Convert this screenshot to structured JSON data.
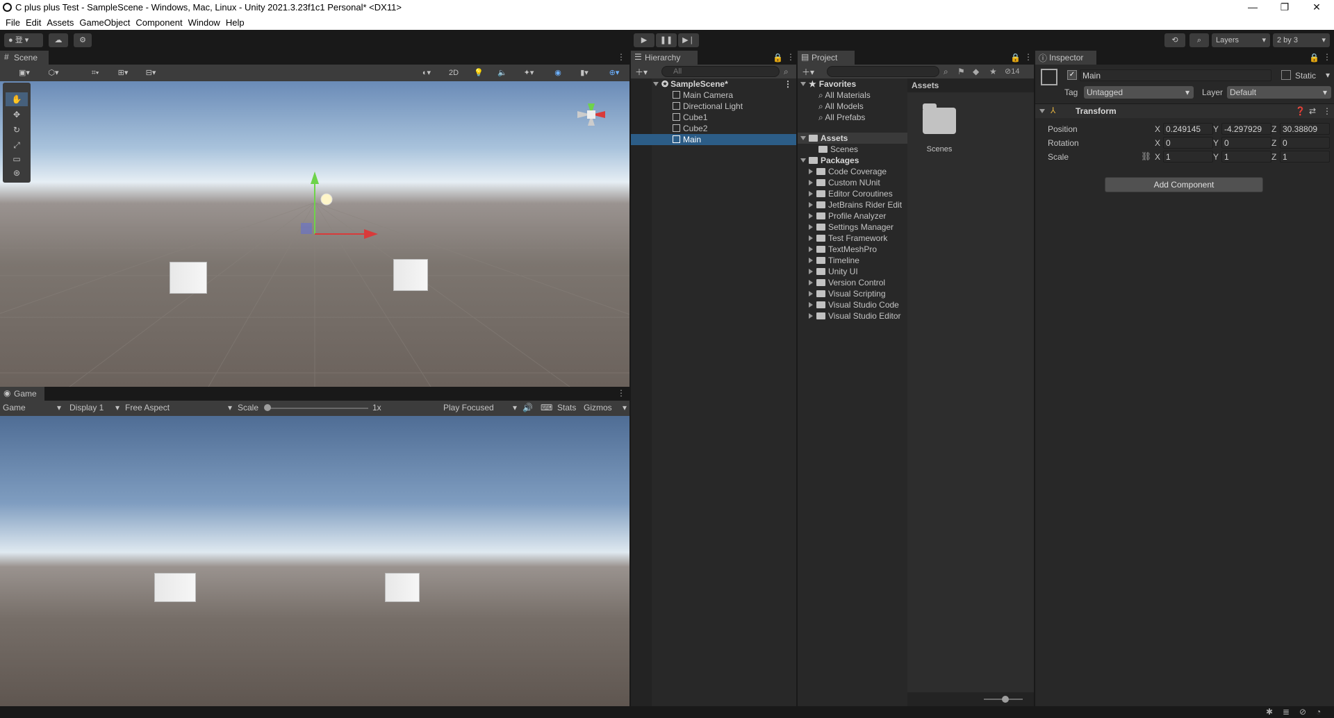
{
  "window": {
    "title": "C plus plus Test - SampleScene - Windows, Mac, Linux - Unity 2021.3.23f1c1 Personal* <DX11>",
    "minimize": "—",
    "restore": "❐",
    "close": "✕"
  },
  "menu": [
    "File",
    "Edit",
    "Assets",
    "GameObject",
    "Component",
    "Window",
    "Help"
  ],
  "toolbar": {
    "account": "登",
    "layers": "Layers",
    "layout": "2 by 3"
  },
  "scene": {
    "tab": "Scene",
    "mode2d": "2D"
  },
  "game": {
    "tab": "Game",
    "game_dropdown": "Game",
    "display": "Display 1",
    "aspect": "Free Aspect",
    "scale_label": "Scale",
    "scale_value": "1x",
    "play_mode": "Play Focused",
    "stats": "Stats",
    "gizmos": "Gizmos"
  },
  "hierarchy": {
    "tab": "Hierarchy",
    "search_placeholder": "All",
    "scene": "SampleScene*",
    "items": [
      "Main Camera",
      "Directional Light",
      "Cube1",
      "Cube2",
      "Main"
    ],
    "selected": "Main"
  },
  "project": {
    "tab": "Project",
    "favorites": "Favorites",
    "fav_items": [
      "All Materials",
      "All Models",
      "All Prefabs"
    ],
    "assets": "Assets",
    "asset_items": [
      "Scenes"
    ],
    "packages": "Packages",
    "package_items": [
      "Code Coverage",
      "Custom NUnit",
      "Editor Coroutines",
      "JetBrains Rider Edit",
      "Profile Analyzer",
      "Settings Manager",
      "Test Framework",
      "TextMeshPro",
      "Timeline",
      "Unity UI",
      "Version Control",
      "Visual Scripting",
      "Visual Studio Code",
      "Visual Studio Editor"
    ],
    "breadcrumb": "Assets",
    "folder": "Scenes",
    "hidden_count": "14"
  },
  "inspector": {
    "tab": "Inspector",
    "name": "Main",
    "static": "Static",
    "tag_label": "Tag",
    "tag": "Untagged",
    "layer_label": "Layer",
    "layer": "Default",
    "component": "Transform",
    "position_label": "Position",
    "rotation_label": "Rotation",
    "scale_label": "Scale",
    "x": "X",
    "y": "Y",
    "z": "Z",
    "position": [
      "0.249145",
      "-4.297929",
      "30.38809"
    ],
    "rotation": [
      "0",
      "0",
      "0"
    ],
    "scale": [
      "1",
      "1",
      "1"
    ],
    "add_component": "Add Component"
  },
  "colors": {
    "selection": "#2c5d87",
    "panel": "#282828",
    "background": "#191919"
  }
}
